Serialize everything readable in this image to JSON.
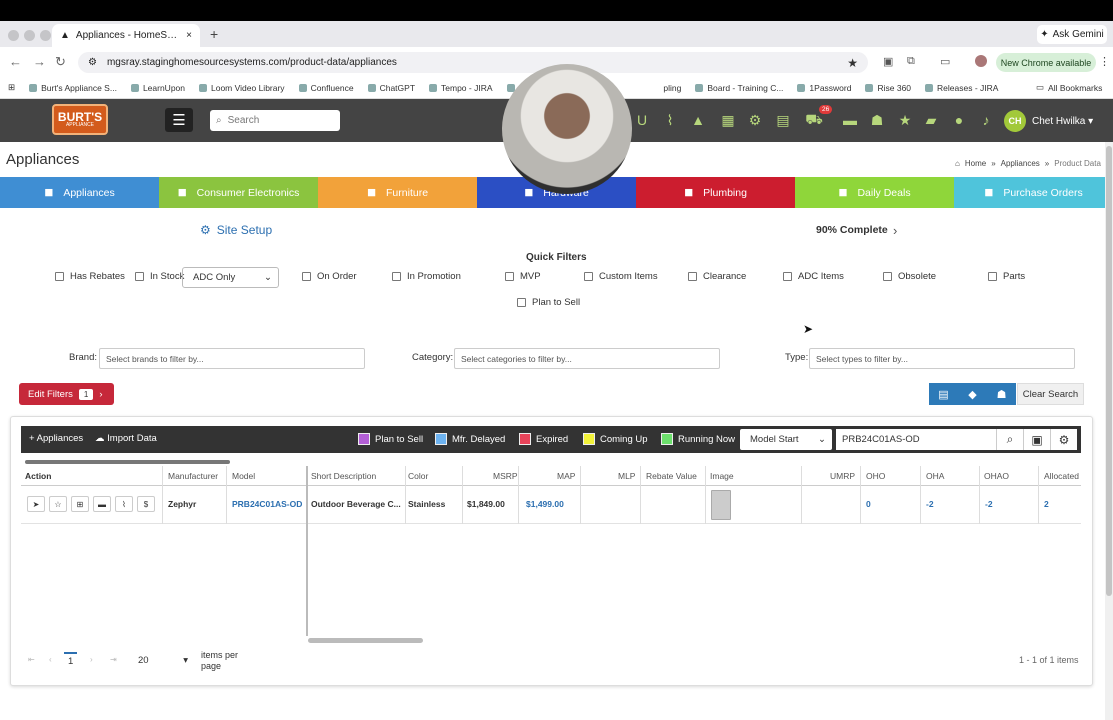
{
  "browser": {
    "tab_title": "Appliances - HomeSource Dev",
    "url": "mgsray.staginghomesourcesystems.com/product-data/appliances",
    "ask_gemini": "Ask Gemini",
    "new_chrome": "New Chrome available",
    "all_bookmarks": "All Bookmarks",
    "bookmarks": [
      "Burt's Appliance S...",
      "LearnUpon",
      "Loom Video Library",
      "Confluence",
      "ChatGPT",
      "Tempo - JIRA",
      "He",
      "pling",
      "Board - Training C...",
      "1Password",
      "Rise 360",
      "Releases - JIRA"
    ]
  },
  "header": {
    "logo": "BURT'S",
    "logo_sub": "APPLIANCE",
    "search_placeholder": "Search",
    "cart_count": "26",
    "avatar_initials": "CH",
    "user_name": "Chet Hwilka"
  },
  "page": {
    "title": "Appliances",
    "breadcrumb": [
      "Home",
      "Appliances",
      "Product Data"
    ]
  },
  "categories": [
    {
      "label": "Appliances",
      "color": "#3f8ed3",
      "icon": "appliance-icon"
    },
    {
      "label": "Consumer Electronics",
      "color": "#8bc43f",
      "icon": "tv-icon"
    },
    {
      "label": "Furniture",
      "color": "#f2a23a",
      "icon": "sofa-icon"
    },
    {
      "label": "Hardware",
      "color": "#2b4fc4",
      "icon": "drill-icon"
    },
    {
      "label": "Plumbing",
      "color": "#cc1d2f",
      "icon": "faucet-icon"
    },
    {
      "label": "Daily Deals",
      "color": "#8fd63a",
      "icon": "trophy-icon"
    },
    {
      "label": "Purchase Orders",
      "color": "#4fc4db",
      "icon": "briefcase-icon"
    }
  ],
  "setup": {
    "site_setup": "Site Setup",
    "complete": "90% Complete"
  },
  "filters": {
    "quick_filters": "Quick Filters",
    "has_rebates": "Has Rebates",
    "in_stock": "In Stock",
    "adc_select": "ADC Only",
    "on_order": "On Order",
    "in_promotion": "In Promotion",
    "mvp": "MVP",
    "custom_items": "Custom Items",
    "clearance": "Clearance",
    "adc_items": "ADC Items",
    "obsolete": "Obsolete",
    "parts": "Parts",
    "plan_to_sell": "Plan to Sell",
    "brand_label": "Brand:",
    "brand_placeholder": "Select brands to filter by...",
    "category_label": "Category:",
    "category_placeholder": "Select categories to filter by...",
    "type_label": "Type:",
    "type_placeholder": "Select types to filter by...",
    "edit_filters": "Edit Filters",
    "edit_count": "1",
    "clear_search": "Clear Search"
  },
  "grid": {
    "appliances_btn": "Appliances",
    "import_btn": "Import Data",
    "legend": [
      {
        "label": "Plan to Sell",
        "color": "#b35fd6"
      },
      {
        "label": "Mfr. Delayed",
        "color": "#6db3f0"
      },
      {
        "label": "Expired",
        "color": "#e8445a"
      },
      {
        "label": "Coming Up",
        "color": "#f2f23a"
      },
      {
        "label": "Running Now",
        "color": "#6de06d"
      }
    ],
    "search_mode": "Model Start",
    "search_value": "PRB24C01AS-OD",
    "headers": {
      "action": "Action",
      "manufacturer": "Manufacturer",
      "model": "Model",
      "short_description": "Short Description",
      "color": "Color",
      "msrp": "MSRP",
      "map": "MAP",
      "mlp": "MLP",
      "rebate_value": "Rebate Value",
      "image": "Image",
      "umrp": "UMRP",
      "oho": "OHO",
      "oha": "OHA",
      "ohao": "OHAO",
      "allocated": "Allocated"
    },
    "rows": [
      {
        "manufacturer": "Zephyr",
        "model": "PRB24C01AS-OD",
        "short_description": "Outdoor Beverage C...",
        "color": "Stainless",
        "msrp": "$1,849.00",
        "map": "$1,499.00",
        "oho": "0",
        "oha": "-2",
        "ohao": "-2",
        "allocated": "2"
      }
    ],
    "page": "1",
    "page_size": "20",
    "per_page_label": "items per page",
    "items_info": "1 - 1 of 1 items"
  }
}
